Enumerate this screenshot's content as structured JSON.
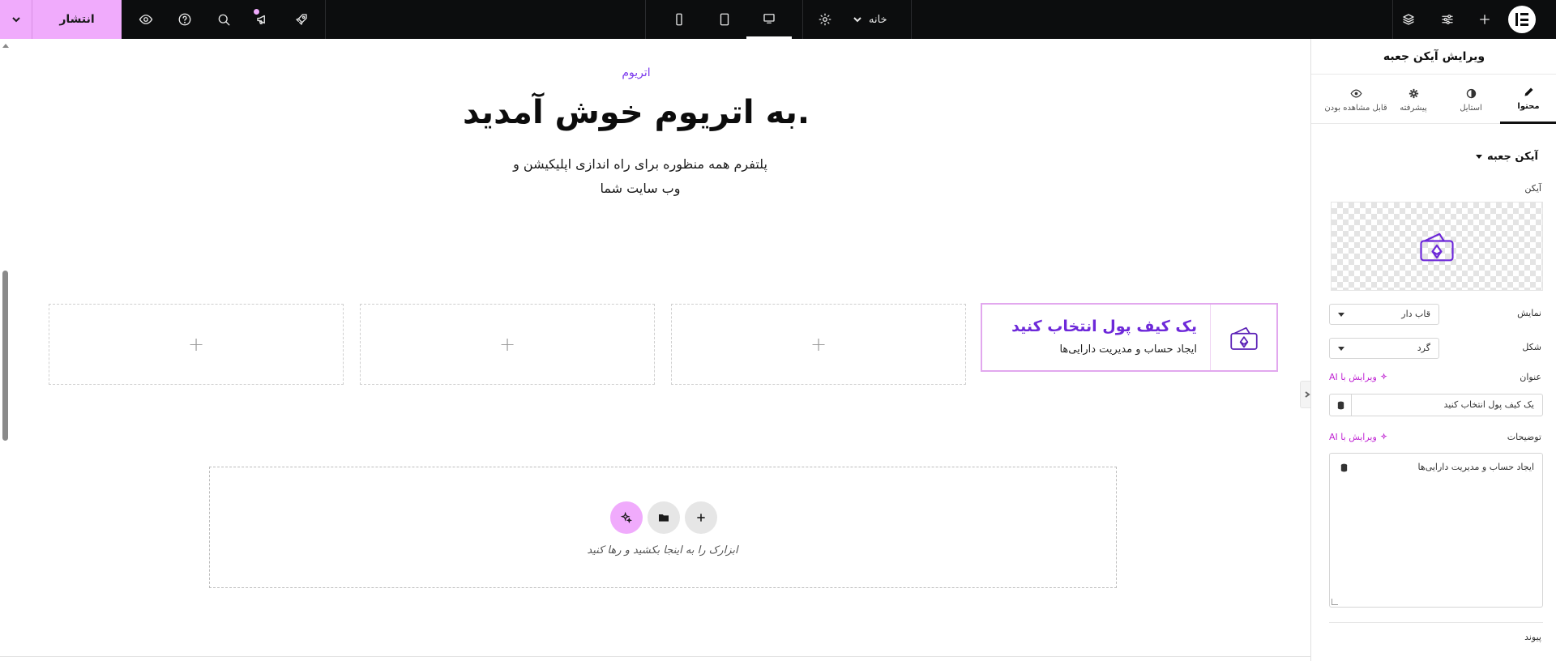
{
  "topbar": {
    "publish_label": "انتشار",
    "page_name": "خانه",
    "toolbar_icons": [
      "chevron-down-icon",
      "eye-icon",
      "help-icon",
      "search-icon",
      "megaphone-icon",
      "rocket-icon",
      "gear-icon",
      "layers-icon",
      "sliders-icon",
      "plus-icon"
    ],
    "devices": [
      "mobile-icon",
      "tablet-icon",
      "desktop-icon"
    ],
    "active_device": "desktop",
    "accent_color": "#f0abfc"
  },
  "canvas": {
    "kicker": "اتریوم",
    "headline": "به اتریوم خوش آمدید.",
    "subtitle_line1": "پلتفرم همه منظوره برای راه اندازی اپلیکیشن و",
    "subtitle_line2": "وب سایت شما",
    "icon_box": {
      "title": "یک کیف پول انتخاب کنید",
      "description": "ایجاد حساب و مدیریت دارایی‌ها",
      "icon": "wallet-icon",
      "title_color": "#6d28d9"
    },
    "empty_slot_symbol": "+",
    "dropzone_hint": "ابزارک را به اینجا بکشید و رها کنید"
  },
  "panel": {
    "title": "ویرایش آیکن جعبه",
    "tabs": [
      {
        "label": "محتوا",
        "icon": "pencil-icon",
        "active": true
      },
      {
        "label": "استایل",
        "icon": "contrast-icon",
        "active": false
      },
      {
        "label": "پیشرفته",
        "icon": "gear-icon",
        "active": false
      },
      {
        "label": "قابل مشاهده بودن",
        "icon": "eye-icon",
        "active": false
      }
    ],
    "section_title": "آیکن جعبه",
    "icon_label": "آیکن",
    "view_label": "نمایش",
    "view_value": "قاب دار",
    "shape_label": "شکل",
    "shape_value": "گرد",
    "title_label": "عنوان",
    "ai_edit_label": "ویرایش با AI",
    "title_value": "یک کیف پول انتخاب کنید",
    "description_label": "توضیحات",
    "description_value": "ایجاد حساب و مدیریت دارایی‌ها",
    "link_label": "پیوند"
  }
}
